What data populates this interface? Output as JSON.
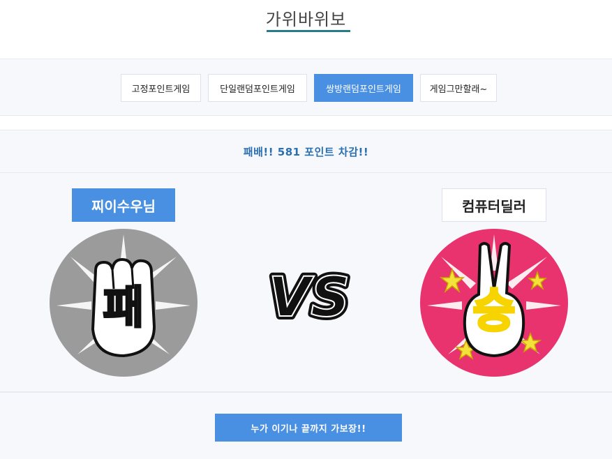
{
  "page": {
    "title": "가위바위보"
  },
  "tabs": [
    {
      "label": "고정포인트게임",
      "active": false
    },
    {
      "label": "단일랜덤포인트게임",
      "active": false
    },
    {
      "label": "쌍방랜덤포인트게임",
      "active": true
    },
    {
      "label": "게임그만할래~",
      "active": false
    }
  ],
  "result": {
    "message": "패배!! 581 포인트 차감!!"
  },
  "player": {
    "name": "찌이수우님",
    "outcome_label": "패"
  },
  "dealer": {
    "name": "컴퓨터딜러",
    "outcome_label": "승"
  },
  "vs_label": "VS",
  "play_button": {
    "label": "누가 이기나 끝까지 가보장!!"
  },
  "colors": {
    "accent": "#4a90e2",
    "result_text": "#2a6fb0",
    "title_underline": "#2a7a8c",
    "player_circle": "#9b9b9b",
    "dealer_circle": "#e8336e"
  }
}
